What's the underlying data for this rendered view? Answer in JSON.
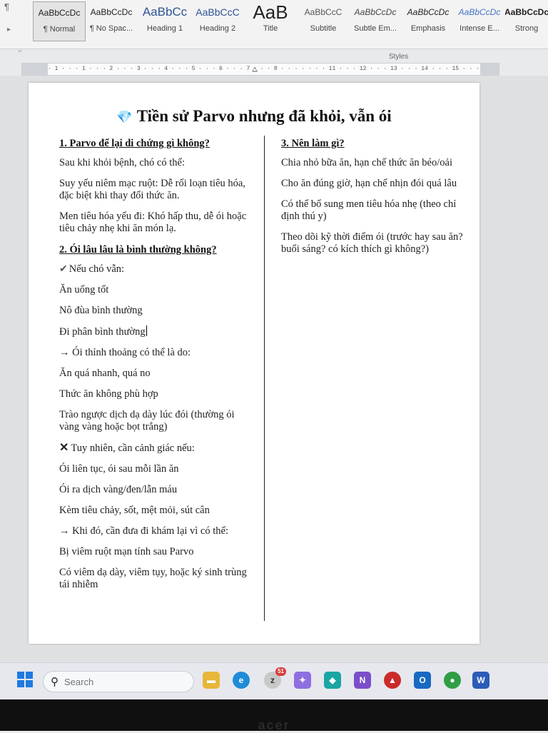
{
  "ribbon": {
    "styles": [
      {
        "sample": "AaBbCcDc",
        "name": "¶ Normal"
      },
      {
        "sample": "AaBbCcDc",
        "name": "¶ No Spac..."
      },
      {
        "sample": "AaBbCc",
        "name": "Heading 1"
      },
      {
        "sample": "AaBbCcC",
        "name": "Heading 2"
      },
      {
        "sample": "AaB",
        "name": "Title"
      },
      {
        "sample": "AaBbCcC",
        "name": "Subtitle"
      },
      {
        "sample": "AaBbCcDc",
        "name": "Subtle Em..."
      },
      {
        "sample": "AaBbCcDc",
        "name": "Emphasis"
      },
      {
        "sample": "AaBbCcDc",
        "name": "Intense E..."
      },
      {
        "sample": "AaBbCcDc",
        "name": "Strong"
      }
    ],
    "group_label": "Styles"
  },
  "ruler": {
    "ticks": "· 1 · · · 1 · · · 2 · · · 3 · · · 4 · · · 5 · · · 6 · · · 7 · · · 8 · · ·   · · · · 11 · · · 12 · · · 13 · · · 14 · · · 15 · · · 16 · · · 17 · · · 18 · · · 19"
  },
  "document": {
    "title": "Tiền sử Parvo nhưng đã khỏi, vẫn ói",
    "title_icon": "gem-icon",
    "left_column": {
      "heading1": "1. Parvo để lại di chứng gì không?",
      "p1": "Sau khi khỏi bệnh, chó có thể:",
      "p2": "Suy yếu niêm mạc ruột: Dễ rối loạn tiêu hóa, đặc biệt khi thay đổi thức ăn.",
      "p3": "Men tiêu hóa yếu đi: Khó hấp thu, dễ ói hoặc tiêu chảy nhẹ khi ăn món lạ.",
      "heading2": "2. Ói lâu lâu là bình thường không?",
      "p4": "Nếu chó vẫn:",
      "p5": "Ăn uống tốt",
      "p6": "Nô đùa bình thường",
      "p7": "Đi phân bình thường",
      "p8": "→ Ói thỉnh thoảng có thể là do:",
      "p9": "Ăn quá nhanh, quá no",
      "p10": "Thức ăn không phù hợp",
      "p11": "Trào ngược dịch dạ dày lúc đói (thường ói vàng vàng hoặc bọt trắng)",
      "p12": "Tuy nhiên, cần cảnh giác nếu:",
      "p13": "Ói liên tục, ói sau mỗi lần ăn",
      "p14": "Ói ra dịch vàng/đen/lẫn máu",
      "p15": "Kèm tiêu chảy, sốt, mệt mỏi, sút cân",
      "p16": "→ Khi đó, cần đưa đi khám lại vì có thể:",
      "p17": "Bị viêm ruột mạn tính sau Parvo",
      "p18": "Có viêm dạ dày, viêm tụy, hoặc ký sinh trùng tái nhiễm"
    },
    "right_column": {
      "heading3": "3. Nên làm gì?",
      "r1": "Chia nhỏ bữa ăn, hạn chế thức ăn béo/oải",
      "r2": "Cho ăn đúng giờ, hạn chế nhịn đói quá lâu",
      "r3": "Có thể bổ sung men tiêu hóa nhẹ (theo chỉ định thú y)",
      "r4": "Theo dõi kỹ thời điểm ói (trước hay sau ăn? buổi sáng? có kích thích gì không?)"
    }
  },
  "taskbar": {
    "search_placeholder": "Search",
    "edge_badge": "51",
    "colors": {
      "accent": "#1f7ae0"
    }
  },
  "bezel": {
    "brand": "acer"
  }
}
